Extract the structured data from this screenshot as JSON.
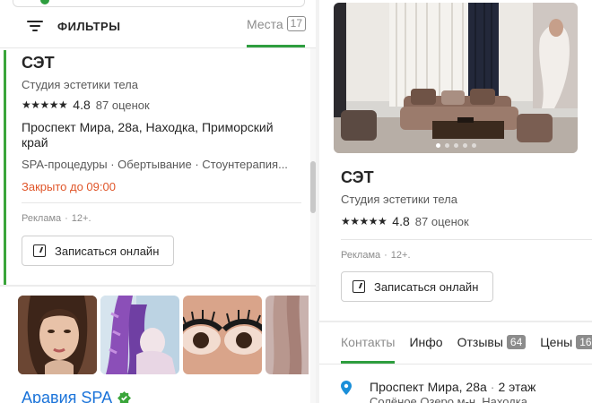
{
  "filters": {
    "label": "ФИЛЬТРЫ",
    "icon": "filter-icon"
  },
  "tabs": {
    "places_label": "Места",
    "places_count": "17"
  },
  "result_card": {
    "name": "СЭТ",
    "category": "Студия эстетики тела",
    "stars": "★★★★★",
    "rating": "4.8",
    "reviews": "87 оценок",
    "address": "Проспект Мира, 28а, Находка, Приморский край",
    "tags": "SPA-процедуры · Обертывание · Стоунтерапия...",
    "status": "Закрыто до 09:00",
    "status_color": "#e0562a",
    "ad_label": "Реклама",
    "age_label": "12+.",
    "book_label": "Записаться онлайн"
  },
  "second_card": {
    "name": "Аравия SPA",
    "name_color": "#1a73d9"
  },
  "detail": {
    "name": "СЭТ",
    "category": "Студия эстетики тела",
    "stars": "★★★★★",
    "rating": "4.8",
    "reviews": "87 оценок",
    "ad_label": "Реклама",
    "age_label": "12+.",
    "book_label": "Записаться онлайн",
    "tabs": [
      {
        "label": "Контакты"
      },
      {
        "label": "Инфо"
      },
      {
        "label": "Отзывы",
        "count": "64"
      },
      {
        "label": "Цены",
        "count": "16"
      }
    ],
    "address_main": "Проспект Мира, 28а",
    "address_floor": "2 этаж",
    "address_sub": "Солёное Озеро м-н, Находка"
  },
  "colors": {
    "accent_green": "#2e9e3f",
    "link_blue": "#1a73d9",
    "pin_blue": "#1a8fd9"
  }
}
